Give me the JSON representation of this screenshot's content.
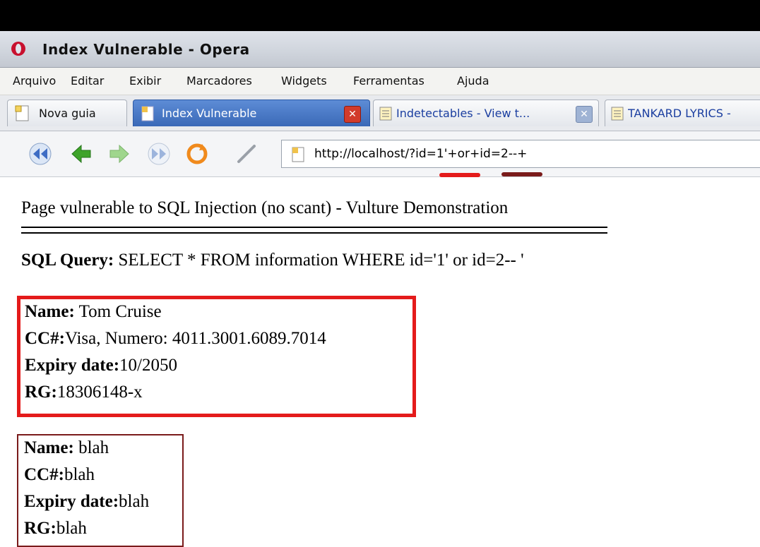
{
  "window": {
    "title": "Index Vulnerable - Opera"
  },
  "menu": [
    "Arquivo",
    "Editar",
    "Exibir",
    "Marcadores",
    "Widgets",
    "Ferramentas",
    "Ajuda"
  ],
  "tabs": [
    {
      "label": "Nova guia",
      "active": false
    },
    {
      "label": "Index Vulnerable",
      "active": true
    },
    {
      "label": "Indetectables - View t...",
      "active": false
    },
    {
      "label": "TANKARD LYRICS -",
      "active": false
    }
  ],
  "address": {
    "url": "http://localhost/?id=1'+or+id=2--+"
  },
  "page": {
    "heading": "Page vulnerable to SQL Injection (no scant) - Vulture Demonstration",
    "sql_label": "SQL Query:",
    "sql_text": " SELECT * FROM information WHERE id='1' or id=2-- '"
  },
  "records": [
    {
      "name_label": "Name:",
      "name": " Tom Cruise",
      "cc_label": "CC#:",
      "cc": "Visa, Numero: 4011.3001.6089.7014",
      "expiry_label": "Expiry date:",
      "expiry": "10/2050",
      "rg_label": "RG:",
      "rg": "18306148-x"
    },
    {
      "name_label": "Name:",
      "name": " blah",
      "cc_label": "CC#:",
      "cc": "blah",
      "expiry_label": "Expiry date:",
      "expiry": "blah",
      "rg_label": "RG:",
      "rg": "blah"
    }
  ],
  "colors": {
    "highlight_red": "#e41b1b",
    "highlight_dark": "#7a1b1b",
    "active_tab": "#3a69b7"
  }
}
